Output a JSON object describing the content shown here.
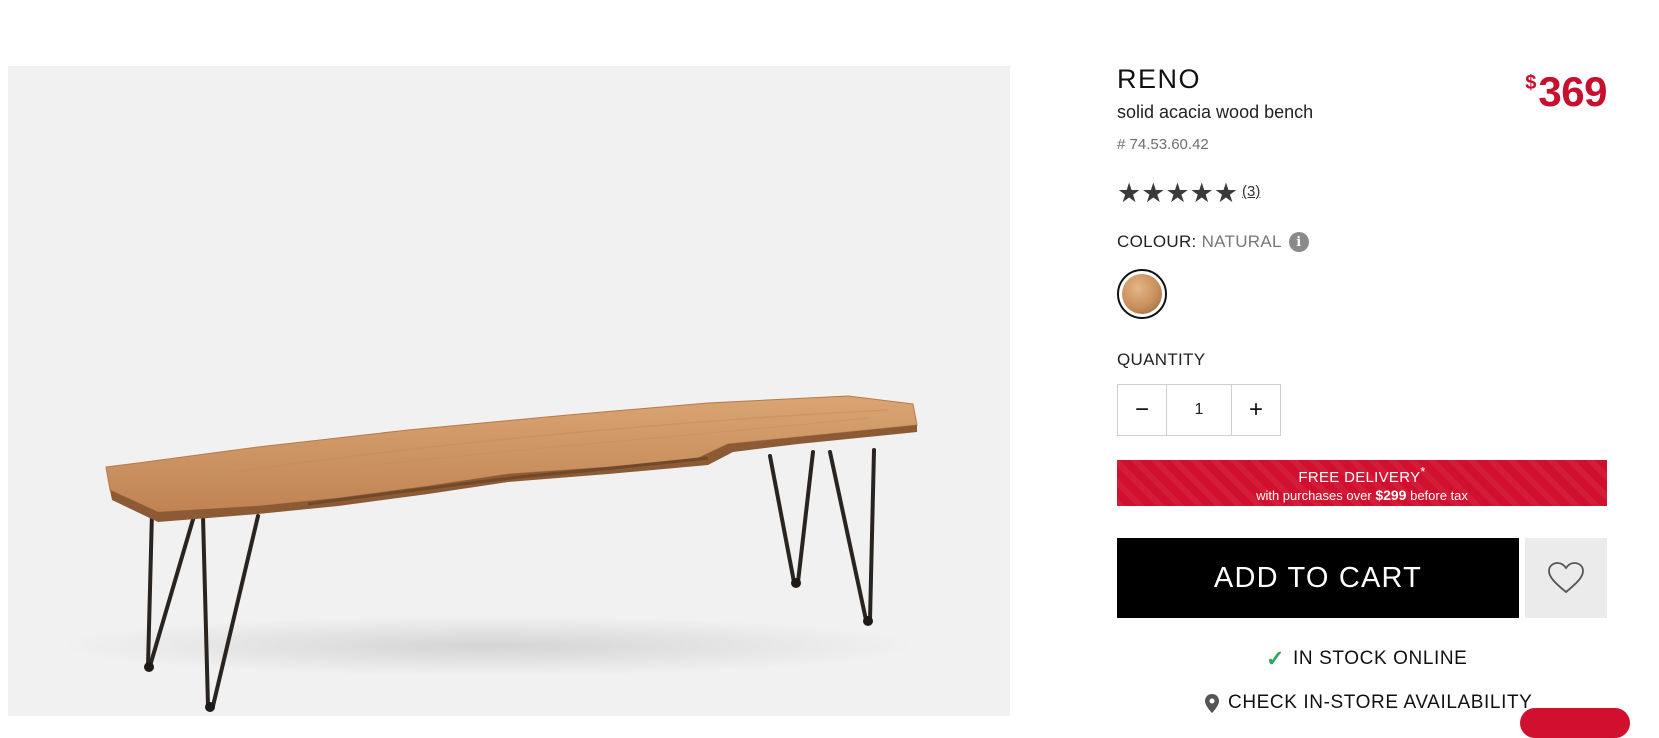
{
  "product": {
    "name": "RENO",
    "subtitle": "solid acacia wood bench",
    "sku": "# 74.53.60.42",
    "price_currency": "$",
    "price_amount": "369",
    "stars": "★★★★★",
    "rating_value": 5,
    "review_count": "(3)"
  },
  "colour": {
    "label": "COLOUR:",
    "value": "NATURAL",
    "info_glyph": "i"
  },
  "quantity": {
    "label": "QUANTITY",
    "value": "1",
    "minus": "−",
    "plus": "+"
  },
  "delivery": {
    "title": "FREE DELIVERY",
    "asterisk": "*",
    "line2_prefix": "with purchases over",
    "line2_amount": "$299",
    "line2_suffix": "before tax"
  },
  "actions": {
    "add_to_cart": "ADD TO CART",
    "wishlist_icon": "heart-icon"
  },
  "availability": {
    "in_stock": "IN STOCK ONLINE",
    "check_store": "CHECK IN-STORE AVAILABILITY"
  },
  "colors": {
    "accent": "#d0102e",
    "price": "#c8102e",
    "check": "#2fa85f"
  }
}
